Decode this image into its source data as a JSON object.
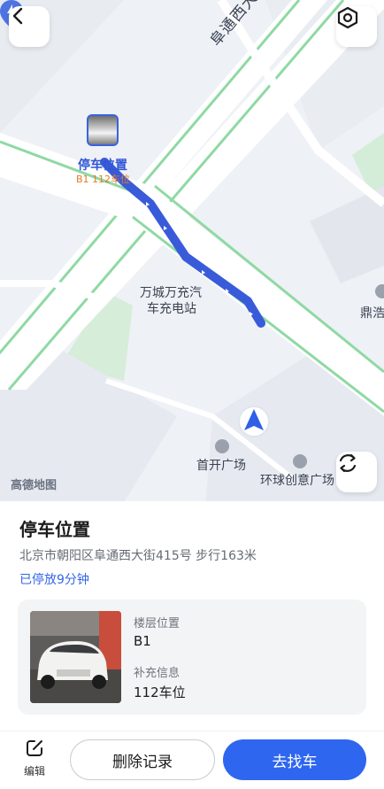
{
  "map": {
    "road_name": "阜通西大街",
    "logo": "高德地图",
    "poi_charge_line1": "万城万充汽",
    "poi_charge_line2": "车充电站",
    "poi_plaza1": "首开广场",
    "poi_plaza2": "环球创意广场",
    "poi_edge": "鼎浩"
  },
  "parking_marker": {
    "title": "停车位置",
    "subtitle": "B1 112车位"
  },
  "sheet": {
    "title": "停车位置",
    "address": "北京市朝阳区阜通西大街415号 步行163米",
    "duration": "已停放9分钟",
    "floor_label": "楼层位置",
    "floor_value": "B1",
    "extra_label": "补充信息",
    "extra_value": "112车位"
  },
  "actions": {
    "edit_label": "编辑",
    "delete_label": "删除记录",
    "find_label": "去找车"
  },
  "colors": {
    "accent": "#2e66ef",
    "route": "#3a5bd9",
    "orange": "#e07b22"
  },
  "icons": {
    "back": "chevron-left-icon",
    "settings": "hexagon-settings-icon",
    "refresh": "refresh-icon",
    "edit": "edit-icon",
    "location": "location-arrow-icon",
    "charge": "charging-station-icon"
  }
}
